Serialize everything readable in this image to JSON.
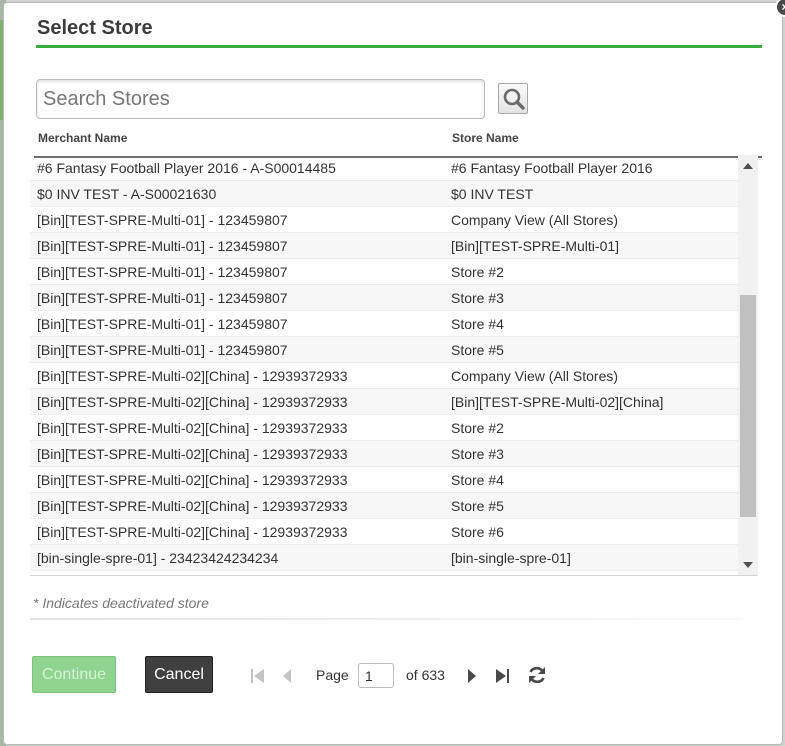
{
  "dialog": {
    "title": "Select Store",
    "close_glyph": "×"
  },
  "search": {
    "placeholder": "Search Stores",
    "value": "",
    "icon": "magnifier-icon"
  },
  "table": {
    "headers": {
      "merchant": "Merchant Name",
      "store": "Store Name"
    },
    "rows": [
      {
        "merchant": "#6 Fantasy Football Player 2016 - A-S00014485",
        "store": "#6 Fantasy Football Player 2016"
      },
      {
        "merchant": "$0 INV TEST - A-S00021630",
        "store": "$0 INV TEST"
      },
      {
        "merchant": "[Bin][TEST-SPRE-Multi-01] - 123459807",
        "store": "Company View (All Stores)"
      },
      {
        "merchant": "[Bin][TEST-SPRE-Multi-01] - 123459807",
        "store": "[Bin][TEST-SPRE-Multi-01]"
      },
      {
        "merchant": "[Bin][TEST-SPRE-Multi-01] - 123459807",
        "store": "Store #2"
      },
      {
        "merchant": "[Bin][TEST-SPRE-Multi-01] - 123459807",
        "store": "Store #3"
      },
      {
        "merchant": "[Bin][TEST-SPRE-Multi-01] - 123459807",
        "store": "Store #4"
      },
      {
        "merchant": "[Bin][TEST-SPRE-Multi-01] - 123459807",
        "store": "Store #5"
      },
      {
        "merchant": "[Bin][TEST-SPRE-Multi-02][China] - 12939372933",
        "store": "Company View (All Stores)"
      },
      {
        "merchant": "[Bin][TEST-SPRE-Multi-02][China] - 12939372933",
        "store": "[Bin][TEST-SPRE-Multi-02][China]"
      },
      {
        "merchant": "[Bin][TEST-SPRE-Multi-02][China] - 12939372933",
        "store": "Store #2"
      },
      {
        "merchant": "[Bin][TEST-SPRE-Multi-02][China] - 12939372933",
        "store": "Store #3"
      },
      {
        "merchant": "[Bin][TEST-SPRE-Multi-02][China] - 12939372933",
        "store": "Store #4"
      },
      {
        "merchant": "[Bin][TEST-SPRE-Multi-02][China] - 12939372933",
        "store": "Store #5"
      },
      {
        "merchant": "[Bin][TEST-SPRE-Multi-02][China] - 12939372933",
        "store": "Store #6"
      },
      {
        "merchant": "[bin-single-spre-01] - 23423424234234",
        "store": "[bin-single-spre-01]"
      }
    ]
  },
  "footnote": "* Indicates deactivated store",
  "buttons": {
    "continue": "Continue",
    "cancel": "Cancel"
  },
  "pager": {
    "page_label": "Page",
    "current_page": "1",
    "of_label": "of 633"
  },
  "colors": {
    "accent_green": "#3aac3e",
    "continue_disabled": "#8fd48f",
    "cancel_dark": "#3f3f3f"
  }
}
